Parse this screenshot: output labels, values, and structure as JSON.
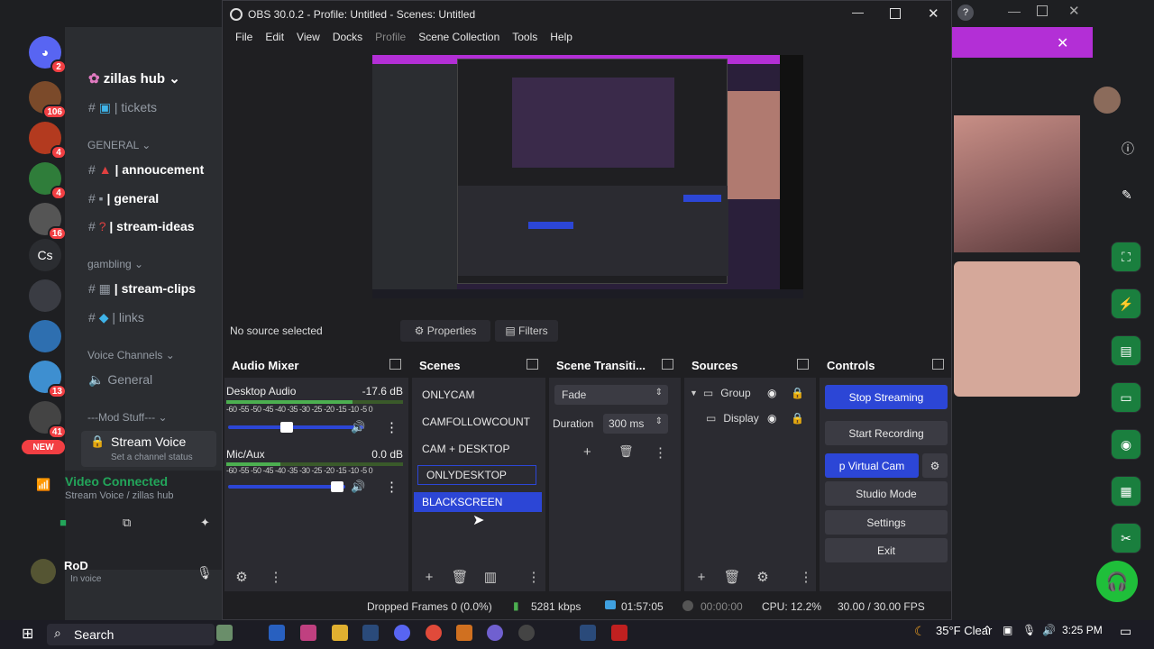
{
  "discord": {
    "server_name": "zillas hub",
    "channels": {
      "tickets": "| tickets",
      "cat_general": "GENERAL",
      "annoucement": "| annoucement",
      "general": "| general",
      "stream_ideas": "| stream-ideas",
      "cat_gambling": "gambling",
      "stream_clips": "| stream-clips",
      "links": "| links",
      "cat_voice": "Voice Channels",
      "voice_general": "General",
      "cat_mod": "---Mod Stuff---",
      "stream_voice": "Stream Voice",
      "set_status": "Set a channel status"
    },
    "voice_status": "Video Connected",
    "voice_sub": "Stream Voice / zillas hub",
    "user_name": "RoD",
    "user_status": "In voice",
    "badges": [
      "2",
      "106",
      "4",
      "4",
      "16",
      "13",
      "41"
    ],
    "server_cs": "Cs",
    "new_label": "NEW"
  },
  "obs": {
    "title": "OBS 30.0.2 - Profile: Untitled - Scenes: Untitled",
    "menu": [
      "File",
      "Edit",
      "View",
      "Docks",
      "Profile",
      "Scene Collection",
      "Tools",
      "Help"
    ],
    "no_source": "No source selected",
    "properties": "Properties",
    "filters": "Filters",
    "audio_mixer": {
      "title": "Audio Mixer",
      "desktop_label": "Desktop Audio",
      "desktop_db": "-17.6 dB",
      "mic_label": "Mic/Aux",
      "mic_db": "0.0 dB",
      "ticks": "-60 -55 -50 -45 -40 -35 -30 -25 -20 -15 -10 -5 0"
    },
    "scenes": {
      "title": "Scenes",
      "items": [
        "ONLYCAM",
        "CAMFOLLOWCOUNT",
        "CAM + DESKTOP",
        "ONLYDESKTOP",
        "BLACKSCREEN"
      ]
    },
    "transitions": {
      "title": "Scene Transiti...",
      "type": "Fade",
      "duration_label": "Duration",
      "duration_value": "300 ms"
    },
    "sources": {
      "title": "Sources",
      "items": [
        "Group",
        "Display"
      ]
    },
    "controls": {
      "title": "Controls",
      "stop_streaming": "Stop Streaming",
      "start_recording": "Start Recording",
      "virtual_cam": "p Virtual Cam",
      "studio_mode": "Studio Mode",
      "settings": "Settings",
      "exit": "Exit"
    },
    "status": {
      "dropped": "Dropped Frames 0 (0.0%)",
      "kbps": "5281 kbps",
      "stream_time": "01:57:05",
      "rec_time": "00:00:00",
      "cpu": "CPU: 12.2%",
      "fps": "30.00 / 30.00 FPS"
    }
  },
  "taskbar": {
    "search": "Search",
    "weather": "35°F  Clear",
    "time": "3:25 PM"
  },
  "colors": {
    "obs_blue": "#2c46d6",
    "discord_purple": "#b32fd6",
    "discord_green": "#23a55a",
    "badge_red": "#f23f43"
  }
}
